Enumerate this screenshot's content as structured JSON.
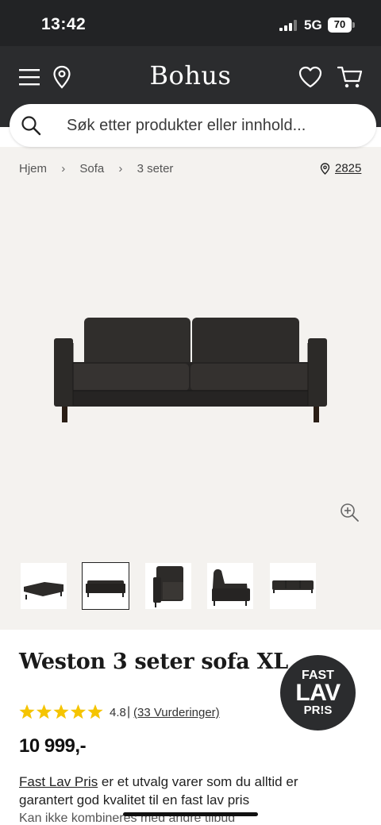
{
  "status_bar": {
    "time": "13:42",
    "network": "5G",
    "battery": "70"
  },
  "header": {
    "logo": "Bohus"
  },
  "search": {
    "placeholder": "Søk etter produkter eller innhold..."
  },
  "breadcrumb": {
    "items": [
      "Hjem",
      "Sofa",
      "3 seter"
    ],
    "store": "2825"
  },
  "product": {
    "title": "Weston 3 seter sofa XL",
    "badge": {
      "line1": "FAST",
      "line2": "LAV",
      "line3": "PR!S"
    },
    "rating": {
      "score": "4.8",
      "separator": "|",
      "count": "(33 Vurderinger)",
      "stars": 5
    },
    "price": "10 999,-",
    "info_link": "Fast Lav Pris",
    "info_text": " er et utvalg varer som du alltid er garantert god kvalitet til en fast lav pris",
    "sub_text": "Kan ikke kombineres med andre tilbud"
  },
  "colors": {
    "header_bg": "#2b2c2e",
    "gallery_bg": "#f4f2ef",
    "star": "#f5c400",
    "sofa": "#2f2d2b"
  },
  "icons": [
    "menu-icon",
    "location-pin-icon",
    "heart-icon",
    "cart-icon",
    "search-icon",
    "zoom-in-icon",
    "star-icon"
  ]
}
